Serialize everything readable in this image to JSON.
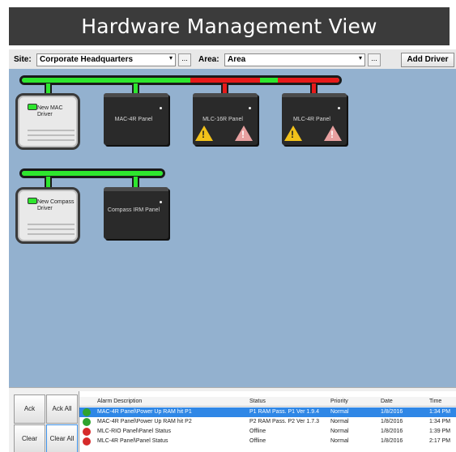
{
  "title": "Hardware Management View",
  "toolbar": {
    "site_label": "Site:",
    "site_value": "Corporate Headquarters",
    "area_label": "Area:",
    "area_value": "Area",
    "dots": "...",
    "add_driver": "Add Driver",
    "dropdown_arrow": "▾"
  },
  "network1": {
    "driver_label": "New MAC Driver",
    "panels": [
      {
        "label": "MAC-4R Panel",
        "status": "ok"
      },
      {
        "label": "MLC-16R Panel",
        "status": "alarm"
      },
      {
        "label": "MLC-4R Panel",
        "status": "alarm"
      }
    ]
  },
  "network2": {
    "driver_label": "New Compass Driver",
    "panels": [
      {
        "label": "Compass IRM Panel",
        "status": "ok"
      }
    ]
  },
  "alarm_buttons": {
    "ack": "Ack",
    "ack_all": "Ack All",
    "clear": "Clear",
    "clear_all": "Clear All"
  },
  "alarm_table": {
    "headers": [
      "Alarm Description",
      "Status",
      "Priority",
      "Date",
      "Time"
    ],
    "rows": [
      {
        "icon": "ok",
        "description": "MAC-4R Panel\\Power Up RAM hit P1",
        "status": "P1 RAM Pass. P1 Ver 1.9.4",
        "priority": "Normal",
        "date": "1/8/2016",
        "time": "1:34 PM",
        "selected": true
      },
      {
        "icon": "ok",
        "description": "MAC-4R Panel\\Power Up RAM hit P2",
        "status": "P2 RAM Pass. P2 Ver 1.7.3",
        "priority": "Normal",
        "date": "1/8/2016",
        "time": "1:34 PM",
        "selected": false
      },
      {
        "icon": "bad",
        "description": "MLC-RIO Panel\\Panel Status",
        "status": "Offline",
        "priority": "Normal",
        "date": "1/8/2016",
        "time": "1:39 PM",
        "selected": false
      },
      {
        "icon": "bad",
        "description": "MLC-4R Panel\\Panel Status",
        "status": "Offline",
        "priority": "Normal",
        "date": "1/8/2016",
        "time": "2:17 PM",
        "selected": false
      }
    ]
  },
  "colors": {
    "canvas": "#93b1cf",
    "bus_ok": "#2ee62e",
    "bus_alarm": "#e61a1a",
    "selected_row": "#2f87e6"
  }
}
